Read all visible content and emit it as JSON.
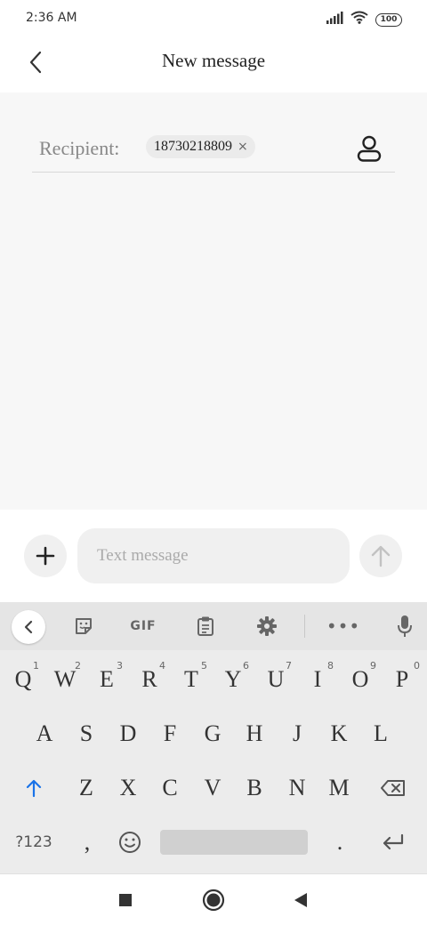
{
  "status_bar": {
    "time": "2:36 AM",
    "battery": "100",
    "icons": [
      "signal-icon",
      "wifi-icon",
      "battery-icon"
    ]
  },
  "header": {
    "title": "New message",
    "back_icon": "chevron-left-icon"
  },
  "recipient": {
    "label": "Recipient:",
    "chip_value": "18730218809",
    "chip_close": "×",
    "contact_icon": "person-icon"
  },
  "composer": {
    "placeholder": "Text message",
    "value": "",
    "add_icon": "plus-icon",
    "send_icon": "arrow-up-icon"
  },
  "keyboard": {
    "toolbar": {
      "gif_label": "GIF",
      "more_label": "•••",
      "icons": [
        "chevron-left-icon",
        "sticker-icon",
        "clipboard-icon",
        "gear-icon",
        "mic-icon"
      ]
    },
    "row1": [
      {
        "key": "Q",
        "hint": "1"
      },
      {
        "key": "W",
        "hint": "2"
      },
      {
        "key": "E",
        "hint": "3"
      },
      {
        "key": "R",
        "hint": "4"
      },
      {
        "key": "T",
        "hint": "5"
      },
      {
        "key": "Y",
        "hint": "6"
      },
      {
        "key": "U",
        "hint": "7"
      },
      {
        "key": "I",
        "hint": "8"
      },
      {
        "key": "O",
        "hint": "9"
      },
      {
        "key": "P",
        "hint": "0"
      }
    ],
    "row2": [
      "A",
      "S",
      "D",
      "F",
      "G",
      "H",
      "J",
      "K",
      "L"
    ],
    "row3": [
      "Z",
      "X",
      "C",
      "V",
      "B",
      "N",
      "M"
    ],
    "bottom": {
      "symbols_label": "?123",
      "comma": ",",
      "period": "."
    },
    "accent_color": "#1a73e8"
  }
}
